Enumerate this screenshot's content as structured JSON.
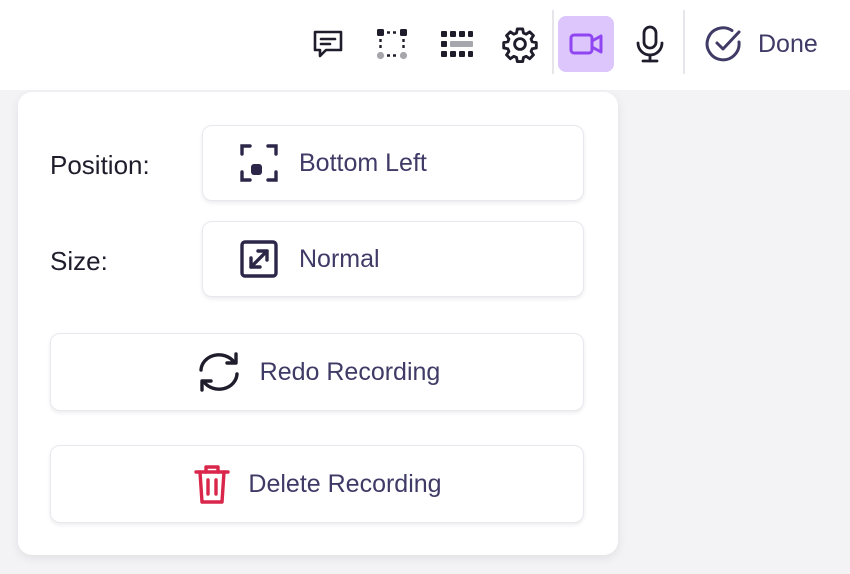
{
  "toolbar": {
    "icons": [
      "comment-icon",
      "selection-icon",
      "grid-icon",
      "gear-icon",
      "video-camera-icon",
      "microphone-icon"
    ],
    "active_icon": "video-camera-icon",
    "done_label": "Done"
  },
  "panel": {
    "position": {
      "label": "Position:",
      "value": "Bottom Left"
    },
    "size": {
      "label": "Size:",
      "value": "Normal"
    },
    "redo_label": "Redo Recording",
    "delete_label": "Delete Recording"
  },
  "colors": {
    "accent": "#8f46f2",
    "accent_bg": "#dcc6fb",
    "text_primary": "#3f3a66",
    "danger": "#d9264a"
  }
}
